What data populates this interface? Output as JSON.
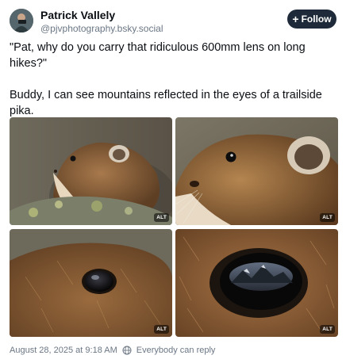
{
  "author": {
    "display_name": "Patrick Vallely",
    "handle": "@pjvphotography.bsky.social"
  },
  "follow_button": {
    "icon": "plus-icon",
    "label": "Follow"
  },
  "post": {
    "paragraph1": "\"Pat, why do you carry that ridiculous 600mm lens on long hikes?\"",
    "paragraph2": "Buddy, I can see mountains reflected in the eyes of a trailside pika."
  },
  "images": [
    {
      "alt_badge": "ALT",
      "subject": "pika on lichen-covered rock"
    },
    {
      "alt_badge": "ALT",
      "subject": "closer crop of pika face"
    },
    {
      "alt_badge": "ALT",
      "subject": "pika eye close-up"
    },
    {
      "alt_badge": "ALT",
      "subject": "extreme close-up of pika eye reflecting mountains"
    }
  ],
  "footer": {
    "timestamp": "August 28, 2025 at 9:18 AM",
    "reply_icon": "globe-icon",
    "reply_setting": "Everybody can reply"
  },
  "colors": {
    "follow_button_bg": "#1e2a39",
    "secondary_text": "#6b7785"
  }
}
